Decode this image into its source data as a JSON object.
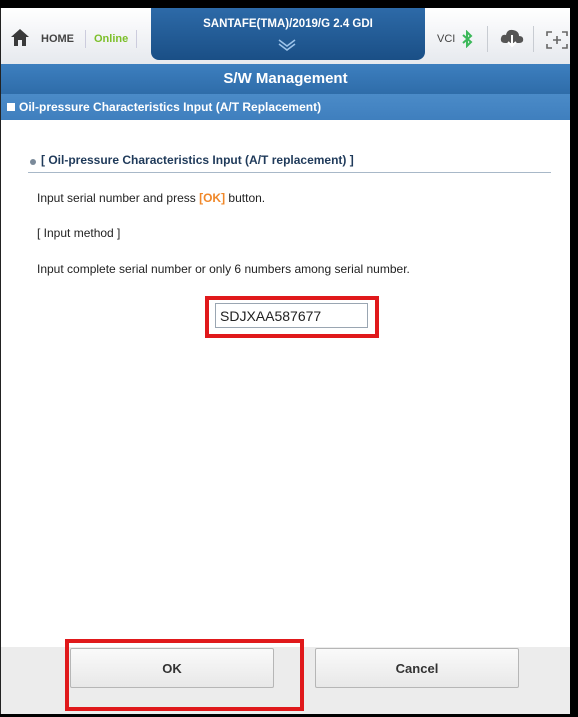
{
  "topbar": {
    "home_label": "HOME",
    "status": "Online",
    "vehicle": "SANTAFE(TMA)/2019/G 2.4 GDI",
    "vci_label": "VCI",
    "icons": [
      "home-icon",
      "chevron-down-icon",
      "bluetooth-icon",
      "cloud-icon",
      "expand-icon"
    ]
  },
  "page": {
    "title": "S/W Management"
  },
  "section": {
    "title": "Oil-pressure Characteristics Input (A/T Replacement)"
  },
  "content": {
    "subtitle": "[ Oil-pressure Characteristics Input (A/T replacement) ]",
    "instruction_prefix": "Input serial number and press ",
    "instruction_ok": "[OK]",
    "instruction_suffix": " button.",
    "method_heading": "[ Input method ]",
    "method_text": "Input complete serial number or only 6 numbers among serial number.",
    "serial_value": "SDJXAA587677"
  },
  "buttons": {
    "ok": "OK",
    "cancel": "Cancel"
  },
  "colors": {
    "accent": "#2f6daa",
    "online": "#7cbf2a",
    "ok_text": "#f0882a",
    "highlight": "#e0191b"
  }
}
